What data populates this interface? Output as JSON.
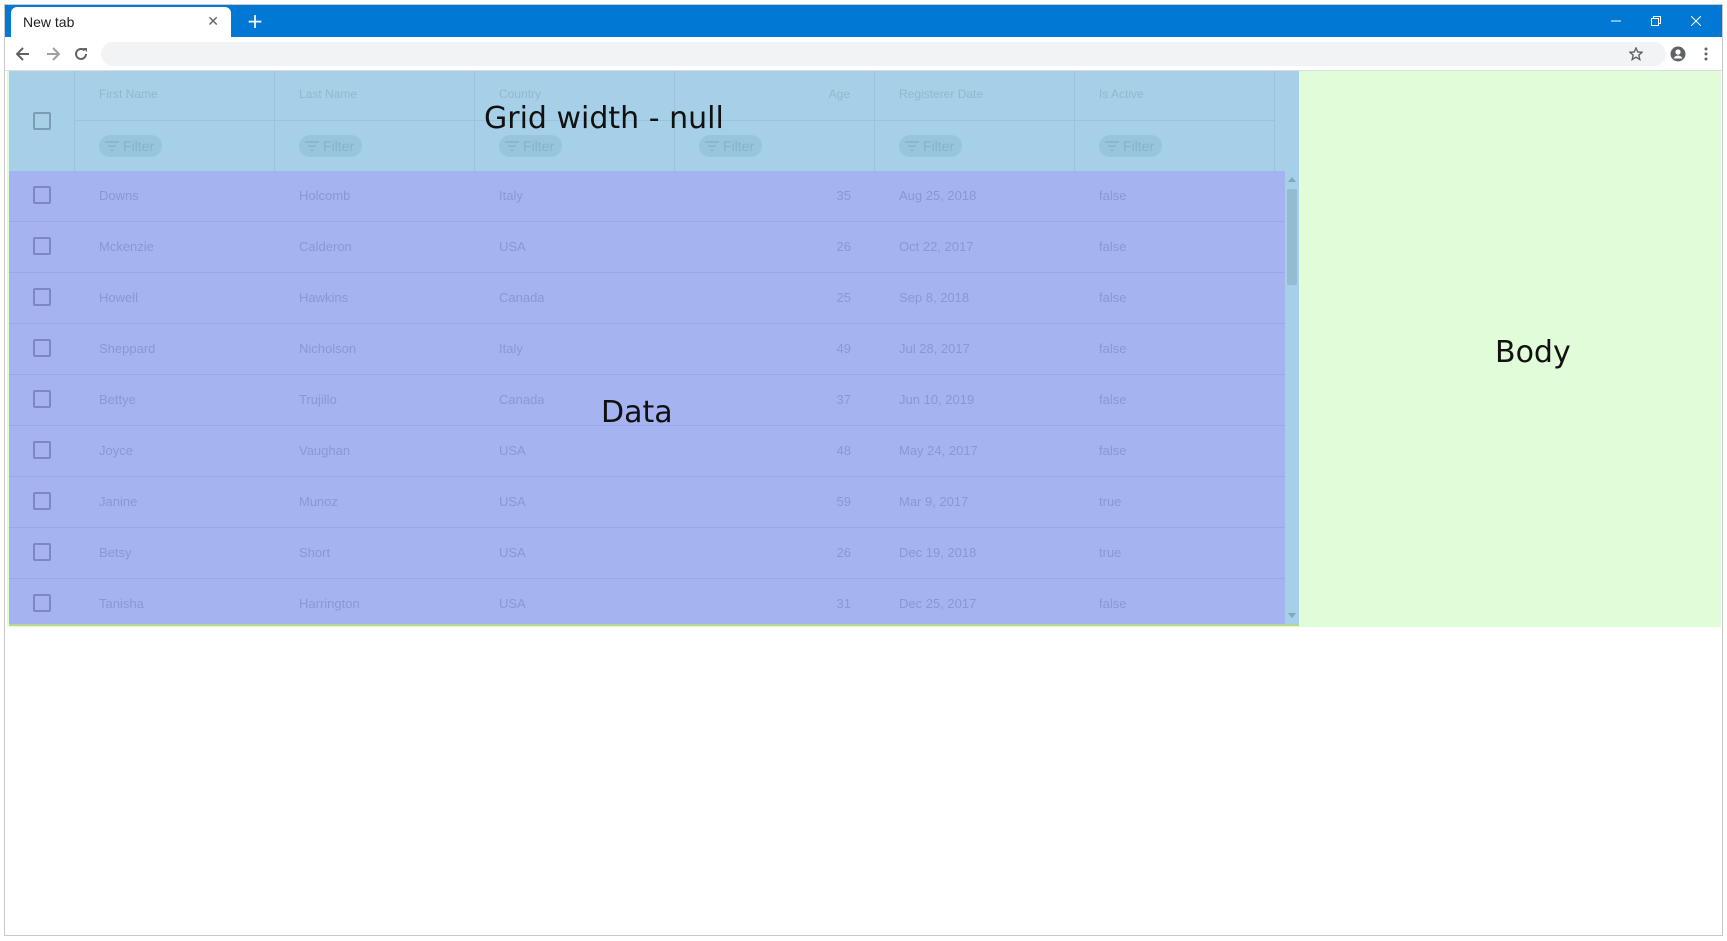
{
  "browser": {
    "tab_title": "New tab",
    "tab_close_icon": "close-icon",
    "new_tab_icon": "plus-icon",
    "window_controls": [
      "minimize-icon",
      "restore-icon",
      "close-icon"
    ],
    "accent_color": "#0078d4"
  },
  "page": {
    "grid_label": "Grid width - null",
    "data_label": "Data",
    "body_label": "Body",
    "colors": {
      "body": "#e1fcd8",
      "grid": "#a5d0e7",
      "data": "#a5b3f0"
    }
  },
  "grid": {
    "columns": [
      {
        "key": "first",
        "label": "First Name",
        "align": "left"
      },
      {
        "key": "last",
        "label": "Last Name",
        "align": "left"
      },
      {
        "key": "country",
        "label": "Country",
        "align": "left"
      },
      {
        "key": "age",
        "label": "Age",
        "align": "right"
      },
      {
        "key": "date",
        "label": "Registerer Date",
        "align": "left"
      },
      {
        "key": "active",
        "label": "Is Active",
        "align": "left"
      }
    ],
    "filter_label": "Filter",
    "rows": [
      {
        "first": "Downs",
        "last": "Holcomb",
        "country": "Italy",
        "age": "35",
        "date": "Aug 25, 2018",
        "active": "false"
      },
      {
        "first": "Mckenzie",
        "last": "Calderon",
        "country": "USA",
        "age": "26",
        "date": "Oct 22, 2017",
        "active": "false"
      },
      {
        "first": "Howell",
        "last": "Hawkins",
        "country": "Canada",
        "age": "25",
        "date": "Sep 8, 2018",
        "active": "false"
      },
      {
        "first": "Sheppard",
        "last": "Nicholson",
        "country": "Italy",
        "age": "49",
        "date": "Jul 28, 2017",
        "active": "false"
      },
      {
        "first": "Bettye",
        "last": "Trujillo",
        "country": "Canada",
        "age": "37",
        "date": "Jun 10, 2019",
        "active": "false"
      },
      {
        "first": "Joyce",
        "last": "Vaughan",
        "country": "USA",
        "age": "48",
        "date": "May 24, 2017",
        "active": "false"
      },
      {
        "first": "Janine",
        "last": "Munoz",
        "country": "USA",
        "age": "59",
        "date": "Mar 9, 2017",
        "active": "true"
      },
      {
        "first": "Betsy",
        "last": "Short",
        "country": "USA",
        "age": "26",
        "date": "Dec 19, 2018",
        "active": "true"
      },
      {
        "first": "Tanisha",
        "last": "Harrington",
        "country": "USA",
        "age": "31",
        "date": "Dec 25, 2017",
        "active": "false"
      }
    ]
  }
}
